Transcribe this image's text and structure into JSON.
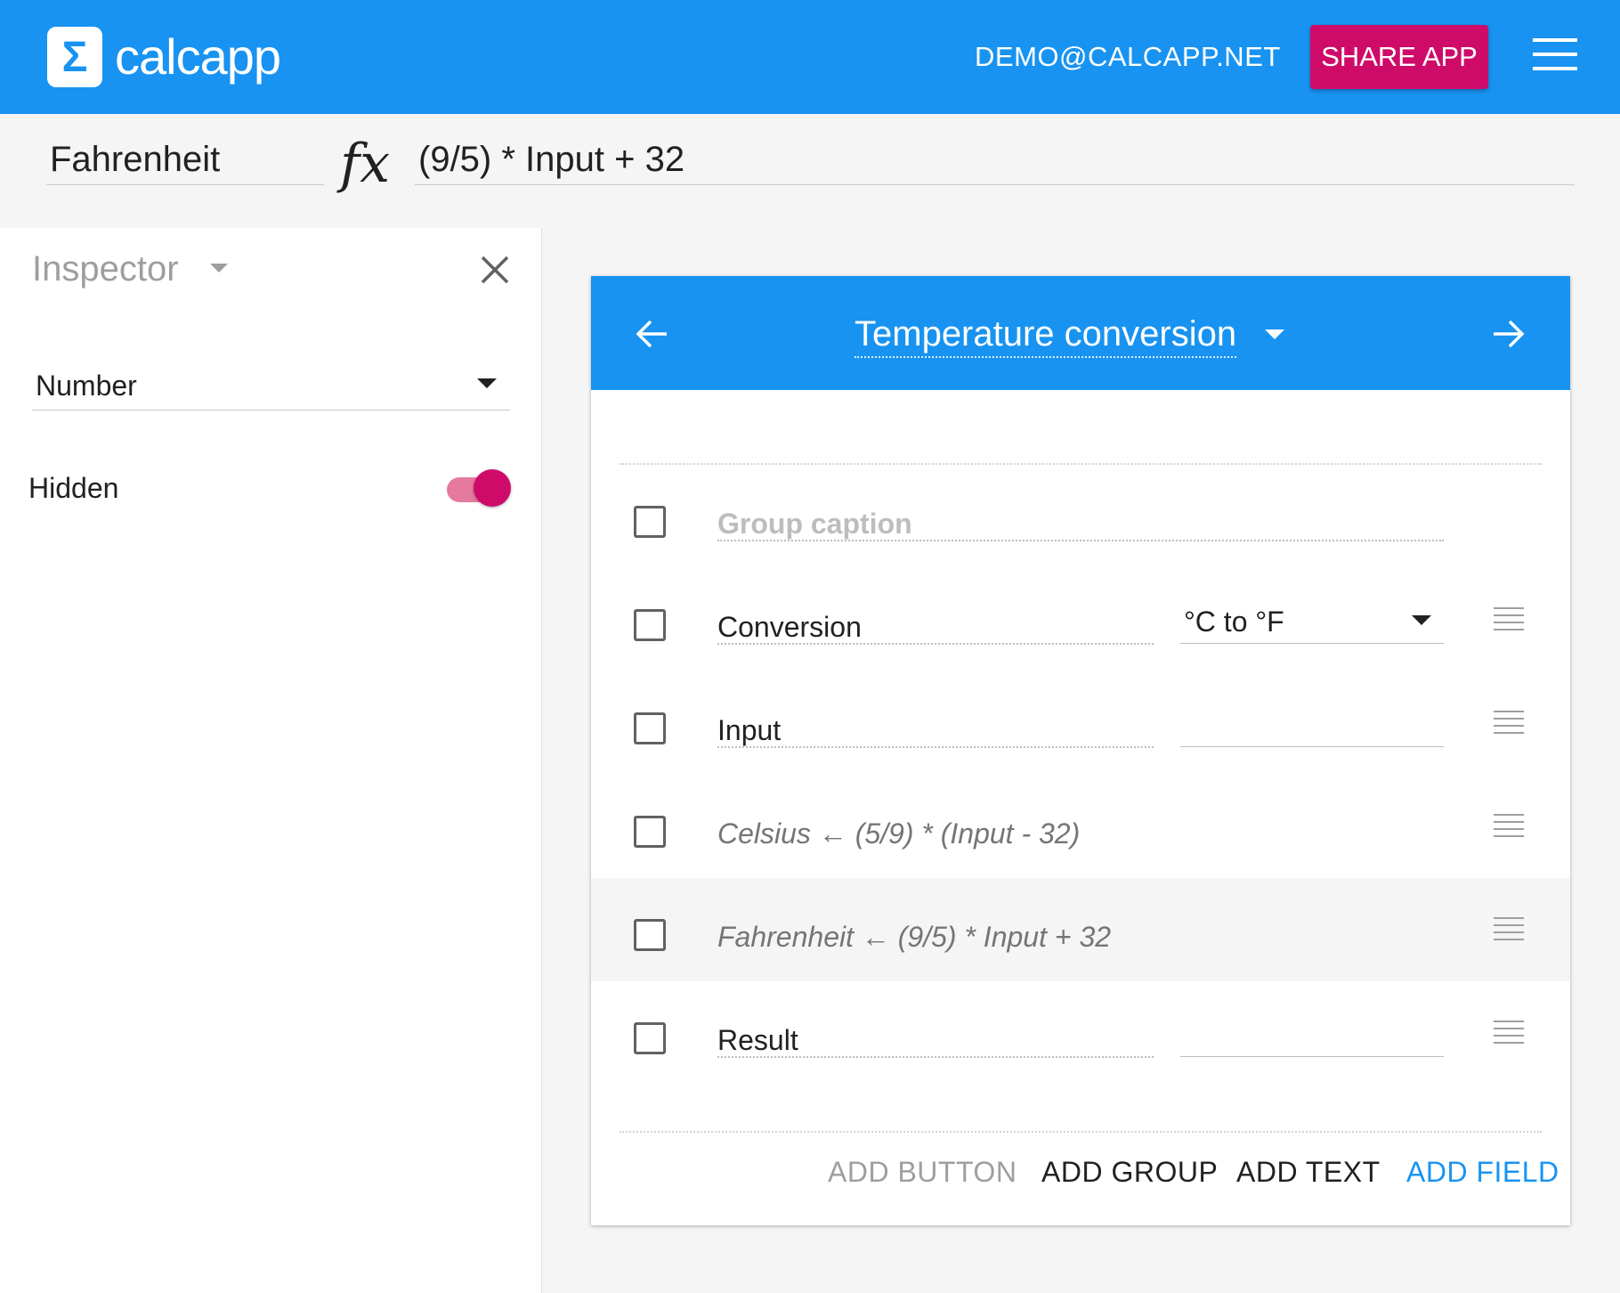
{
  "header": {
    "logo_symbol": "Σ",
    "logo_text": "calcapp",
    "account": "DEMO@CALCAPP.NET",
    "share_label": "SHARE APP",
    "menu_icon": "hamburger-menu-icon"
  },
  "formula_bar": {
    "field_name": "Fahrenheit",
    "fx_label": "fx",
    "formula": "(9/5) * Input + 32"
  },
  "inspector": {
    "title": "Inspector",
    "type_value": "Number",
    "hidden_label": "Hidden",
    "hidden_on": true
  },
  "panel": {
    "title": "Temperature conversion",
    "rows": [
      {
        "kind": "group",
        "placeholder": "Group caption"
      },
      {
        "kind": "field",
        "label": "Conversion",
        "value": "°C to °F"
      },
      {
        "kind": "field",
        "label": "Input",
        "value": ""
      },
      {
        "kind": "calc",
        "name": "Celsius",
        "arrow": "←",
        "formula": "(5/9) * (Input - 32)"
      },
      {
        "kind": "calc",
        "name": "Fahrenheit",
        "arrow": "←",
        "formula": "(9/5) * Input + 32",
        "selected": true
      },
      {
        "kind": "field",
        "label": "Result",
        "value": ""
      }
    ],
    "footer": {
      "add_button": "ADD BUTTON",
      "add_group": "ADD GROUP",
      "add_text": "ADD TEXT",
      "add_field": "ADD FIELD"
    }
  },
  "colors": {
    "brand_blue": "#1893f1",
    "accent_pink": "#cf0b69",
    "toggle_track": "#e6799f"
  }
}
